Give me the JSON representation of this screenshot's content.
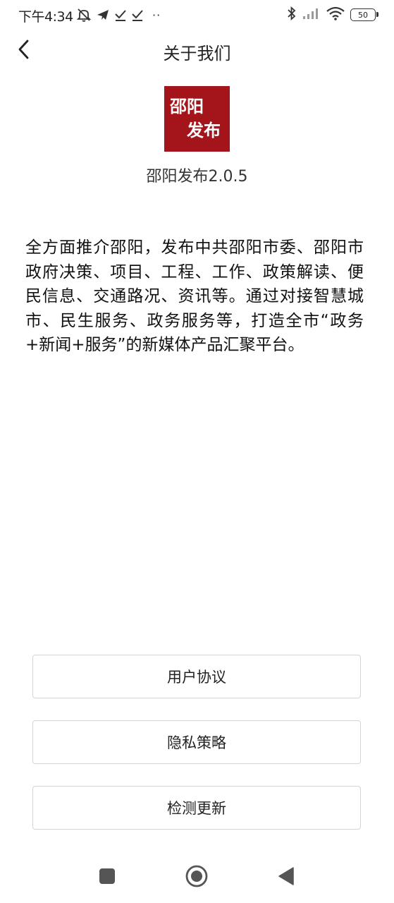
{
  "status_bar": {
    "time": "下午4:34",
    "dots": "··",
    "battery": "50",
    "icons": [
      "notifications-off-icon",
      "telegram-icon",
      "download-check-icon",
      "download-check-icon",
      "bluetooth-icon",
      "signal-icon",
      "wifi-icon",
      "battery-icon"
    ]
  },
  "header": {
    "title": "关于我们",
    "back_icon": "chevron-left-icon"
  },
  "about": {
    "logo_line_1": "邵阳",
    "logo_line_2": "发布",
    "logo_color": "#a3141b",
    "app_version": "邵阳发布2.0.5",
    "description": "全方面推介邵阳，发布中共邵阳市委、邵阳市政府决策、项目、工程、工作、政策解读、便民信息、交通路况、资讯等。通过对接智慧城市、民生服务、政务服务等，打造全市“政务+新闻+服务”的新媒体产品汇聚平台。"
  },
  "buttons": {
    "user_agreement": "用户协议",
    "privacy_policy": "隐私策略",
    "check_update": "检测更新"
  },
  "nav_bar": {
    "icons": [
      "recents-square-icon",
      "home-circle-icon",
      "back-triangle-icon"
    ]
  }
}
